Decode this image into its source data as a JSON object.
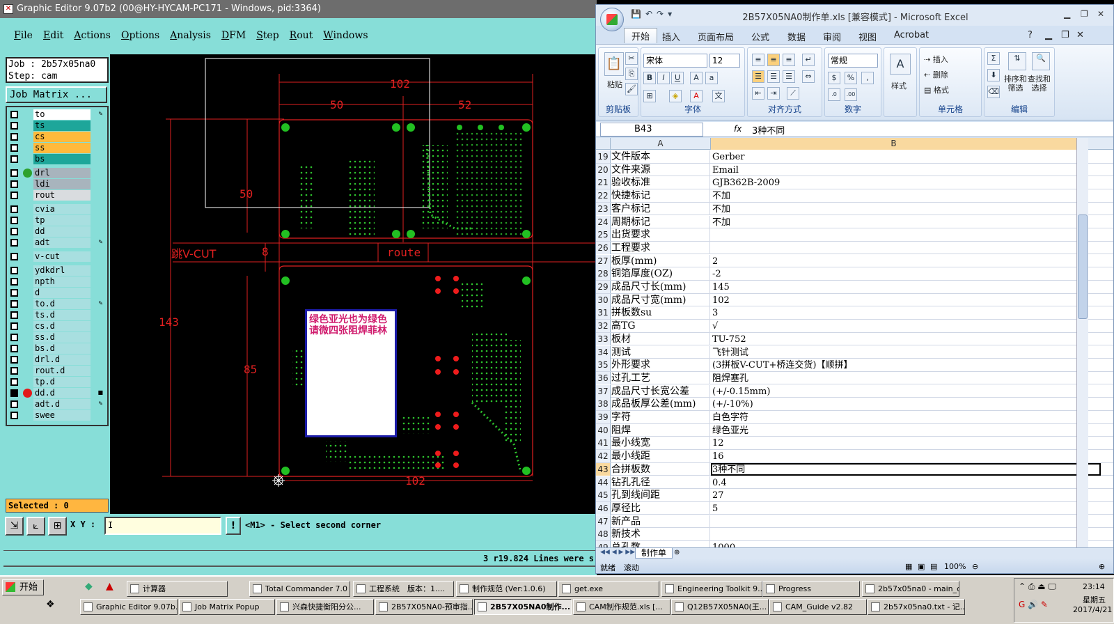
{
  "ge": {
    "title": "Graphic Editor 9.07b2 (00@HY-HYCAM-PC171 - Windows, pid:3364)",
    "menu": [
      "File",
      "Edit",
      "Actions",
      "Options",
      "Analysis",
      "DFM",
      "Step",
      "Rout",
      "Windows"
    ],
    "job": "Job : 2b57x05na0",
    "step": "Step: cam",
    "job_matrix": "Job Matrix ...",
    "layers": [
      {
        "name": "to",
        "color": "#ffffff",
        "mark": "pencil"
      },
      {
        "name": "ts",
        "color": "#1ea69a"
      },
      {
        "name": "cs",
        "color": "#ffba3c"
      },
      {
        "name": "ss",
        "color": "#ffba3c"
      },
      {
        "name": "bs",
        "color": "#1ea69a"
      },
      {
        "name": "drl",
        "color": "#a8b4bd",
        "dot": "#2ea12e"
      },
      {
        "name": "ldi",
        "color": "#a8b4bd"
      },
      {
        "name": "rout",
        "color": "#d9dcdf"
      },
      {
        "name": "cvia",
        "color": "#a8dfe0"
      },
      {
        "name": "tp",
        "color": "#a8dfe0"
      },
      {
        "name": "dd",
        "color": "#a8dfe0"
      },
      {
        "name": "adt",
        "color": "#a8dfe0",
        "mark": "pencil"
      },
      {
        "name": "v-cut",
        "color": "#a8dfe0"
      },
      {
        "name": "ydkdrl",
        "color": "#a8dfe0"
      },
      {
        "name": "npth",
        "color": "#a8dfe0"
      },
      {
        "name": "d",
        "color": "#a8dfe0"
      },
      {
        "name": "to.d",
        "color": "#a8dfe0",
        "mark": "pencil"
      },
      {
        "name": "ts.d",
        "color": "#a8dfe0"
      },
      {
        "name": "cs.d",
        "color": "#a8dfe0"
      },
      {
        "name": "ss.d",
        "color": "#a8dfe0"
      },
      {
        "name": "bs.d",
        "color": "#a8dfe0"
      },
      {
        "name": "drl.d",
        "color": "#a8dfe0"
      },
      {
        "name": "rout.d",
        "color": "#a8dfe0"
      },
      {
        "name": "tp.d",
        "color": "#a8dfe0"
      },
      {
        "name": "dd.d",
        "color": "#a8dfe0",
        "dot": "#e21a1a",
        "selected": true,
        "mark": "square"
      },
      {
        "name": "adt.d",
        "color": "#a8dfe0",
        "mark": "pencil"
      },
      {
        "name": "swee",
        "color": "#a8dfe0"
      }
    ],
    "selected": "Selected : 0",
    "xy_label": "X Y :",
    "xy_value": "I",
    "excl": "!",
    "prompt": "<M1> - Select second corner",
    "status": "3 r19.824 Lines were s",
    "canvas": {
      "dims": {
        "d102": "102",
        "d50": "50",
        "d52": "52",
        "d50v": "50",
        "d8": "8",
        "d143": "143",
        "d85": "85",
        "d102b": "102",
        "vcut": "跳V-CUT",
        "route": "route"
      },
      "note": "绿色亚光也为绿色　请微四张阻焊菲林"
    }
  },
  "xl": {
    "title": "2B57X05NA0制作单.xls [兼容模式] - Microsoft Excel",
    "tabs": [
      "开始",
      "插入",
      "页面布局",
      "公式",
      "数据",
      "审阅",
      "视图",
      "Acrobat"
    ],
    "ribbon": {
      "paste": "粘贴",
      "clipboard": "剪贴板",
      "font_name": "宋体",
      "font_size": "12",
      "font": "字体",
      "align": "对齐方式",
      "numfmt": "常规",
      "number": "数字",
      "style": "样式",
      "insert": "插入",
      "delete": "删除",
      "format": "格式",
      "cells": "单元格",
      "sort": "排序和\n筛选",
      "find": "查找和\n选择",
      "edit": "编辑"
    },
    "namebox": "B43",
    "fx": "3种不同",
    "cols": [
      "A",
      "B"
    ],
    "rows": [
      [
        "19",
        "文件版本",
        "Gerber"
      ],
      [
        "20",
        "文件来源",
        "Email"
      ],
      [
        "21",
        "验收标准",
        "GJB362B-2009"
      ],
      [
        "22",
        "快捷标记",
        "不加"
      ],
      [
        "23",
        "客户标记",
        "不加"
      ],
      [
        "24",
        "周期标记",
        "不加"
      ],
      [
        "25",
        "出货要求",
        ""
      ],
      [
        "26",
        "工程要求",
        ""
      ],
      [
        "27",
        "板厚(mm)",
        "2"
      ],
      [
        "28",
        "铜箔厚度(OZ)",
        "-2"
      ],
      [
        "29",
        "成品尺寸长(mm)",
        "145"
      ],
      [
        "30",
        "成品尺寸宽(mm)",
        "102"
      ],
      [
        "31",
        "拼板数su",
        "3"
      ],
      [
        "32",
        "高TG",
        "√"
      ],
      [
        "33",
        "板材",
        "TU-752"
      ],
      [
        "34",
        "测试",
        "飞针测试"
      ],
      [
        "35",
        "外形要求",
        "(3拼板V-CUT+桥连交货)【顺拼】"
      ],
      [
        "36",
        "过孔工艺",
        "阻焊塞孔"
      ],
      [
        "37",
        "成品尺寸长宽公差",
        "(+/-0.15mm)"
      ],
      [
        "38",
        "成品板厚公差(mm)",
        "(+/-10%)"
      ],
      [
        "39",
        "字符",
        "白色字符"
      ],
      [
        "40",
        "阻焊",
        "绿色亚光"
      ],
      [
        "41",
        "最小线宽",
        "12"
      ],
      [
        "42",
        "最小线距",
        "16"
      ],
      [
        "43",
        "合拼板数",
        "3种不同"
      ],
      [
        "44",
        "钻孔孔径",
        "0.4"
      ],
      [
        "45",
        "孔到线间距",
        "27"
      ],
      [
        "46",
        "厚径比",
        "5"
      ],
      [
        "47",
        "新产品",
        ""
      ],
      [
        "48",
        "新技术",
        ""
      ],
      [
        "49",
        "总孔数",
        "1000"
      ]
    ],
    "sheet": "制作单",
    "status": [
      "就绪",
      "滚动"
    ],
    "zoom": "100%"
  },
  "taskbar": {
    "start": "开始",
    "row1": [
      "计算器",
      "Total Commander 7.0 ...",
      "工程系统　版本：1....",
      "制作规范 (Ver:1.0.6)",
      "get.exe",
      "Engineering Toolkit 9....",
      "Progress",
      "2b57x05na0 - main_qa"
    ],
    "row2": [
      "Graphic Editor 9.07b...",
      "Job Matrix Popup",
      "兴森快捷衡阳分公...",
      "2B57X05NA0-预审指...",
      "2B57X05NA0制作...",
      "CAM制作规范.xls [...",
      "Q12B57X05NA0(王...",
      "CAM_Guide v2.82",
      "2b57x05na0.txt - 记..."
    ],
    "time": "23:14",
    "weekday": "星期五",
    "date": "2017/4/21"
  }
}
